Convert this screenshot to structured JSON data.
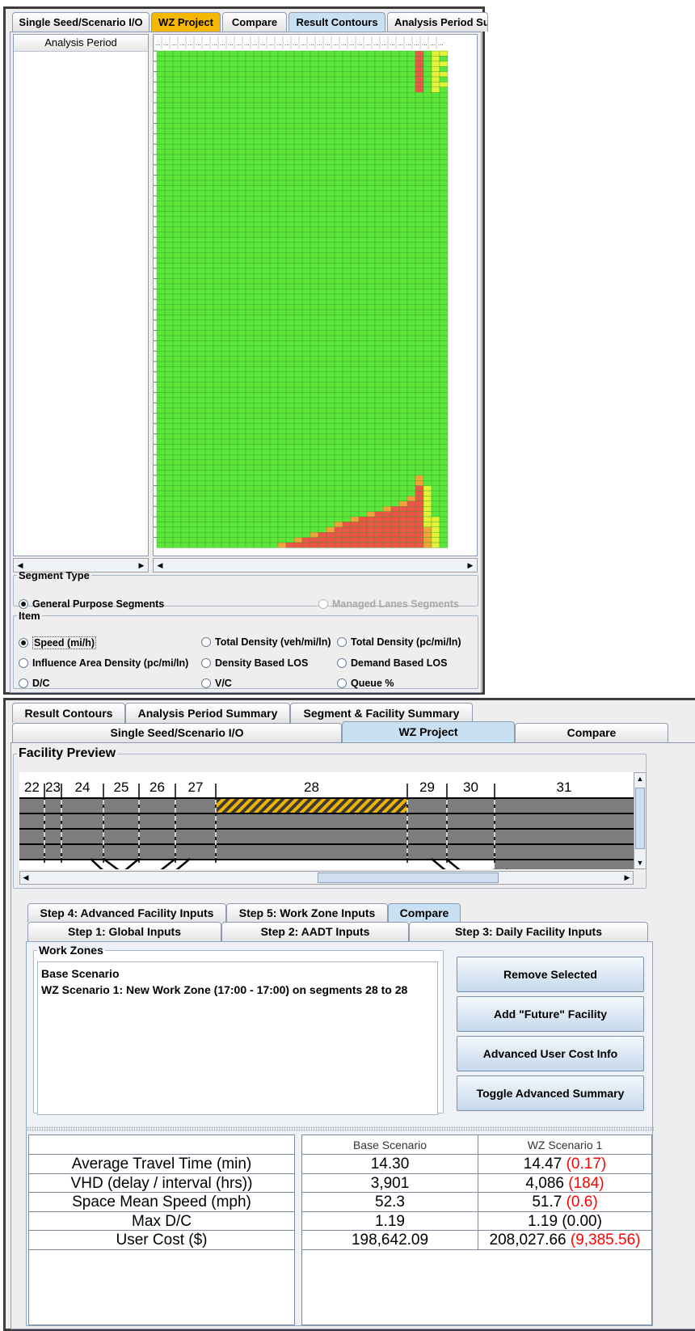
{
  "top": {
    "tabs": [
      "Single Seed/Scenario I/O",
      "WZ Project",
      "Compare",
      "Result Contours",
      "Analysis Period Sur"
    ],
    "list_header": "Analysis Period",
    "segment_type": {
      "legend": "Segment Type",
      "options": [
        {
          "label": "General Purpose Segments",
          "selected": true
        },
        {
          "label": "Managed Lanes Segments",
          "selected": false
        }
      ]
    },
    "item": {
      "legend": "Item",
      "options": [
        "Speed (mi/h)",
        "Total Density (veh/mi/ln)",
        "Total Density (pc/mi/ln)",
        "Influence Area Density (pc/mi/ln)",
        "Density Based LOS",
        "Demand Based LOS",
        "D/C",
        "V/C",
        "Queue %"
      ],
      "selected": "Speed (mi/h)"
    },
    "contour": {
      "header_dots": "...",
      "colors": {
        "green": "#5ce63c",
        "yellow": "#e5f23a",
        "orange": "#f2a43a",
        "red": "#ee5548"
      }
    }
  },
  "bottom": {
    "tabs_row1": [
      "Result Contours",
      "Analysis Period Summary",
      "Segment & Facility Summary"
    ],
    "tabs_row2": [
      "Single Seed/Scenario I/O",
      "WZ Project",
      "Compare"
    ],
    "facility_preview": {
      "title": "Facility Preview",
      "segments": [
        "22",
        "23",
        "24",
        "25",
        "26",
        "27",
        "28",
        "29",
        "30",
        "31"
      ],
      "work_zone_color": "#f0b400"
    },
    "steps_row1": [
      "Step 4: Advanced Facility Inputs",
      "Step 5: Work Zone Inputs",
      "Compare"
    ],
    "steps_row2": [
      "Step 1: Global Inputs",
      "Step 2: AADT Inputs",
      "Step 3: Daily Facility Inputs"
    ],
    "work_zones": {
      "legend": "Work Zones",
      "items": [
        "Base Scenario",
        "WZ Scenario 1: New Work Zone (17:00 - 17:00) on segments 28 to 28"
      ]
    },
    "buttons": [
      "Remove Selected",
      "Add \"Future\" Facility",
      "Advanced User Cost Info",
      "Toggle Advanced Summary"
    ],
    "summary": {
      "headers": [
        "Base Scenario",
        "WZ Scenario 1"
      ],
      "rows": [
        {
          "label": "Average Travel Time (min)",
          "base": "14.30",
          "wz": "14.47",
          "diff": "(0.17)",
          "diff_red": true
        },
        {
          "label": "VHD (delay / interval (hrs))",
          "base": "3,901",
          "wz": "4,086",
          "diff": "(184)",
          "diff_red": true
        },
        {
          "label": "Space Mean Speed (mph)",
          "base": "52.3",
          "wz": "51.7",
          "diff": "(0.6)",
          "diff_red": true
        },
        {
          "label": "Max D/C",
          "base": "1.19",
          "wz": "1.19",
          "diff": "(0.00)",
          "diff_red": false
        },
        {
          "label": "User Cost ($)",
          "base": "198,642.09",
          "wz": "208,027.66",
          "diff": "(9,385.56)",
          "diff_red": true
        }
      ]
    }
  }
}
